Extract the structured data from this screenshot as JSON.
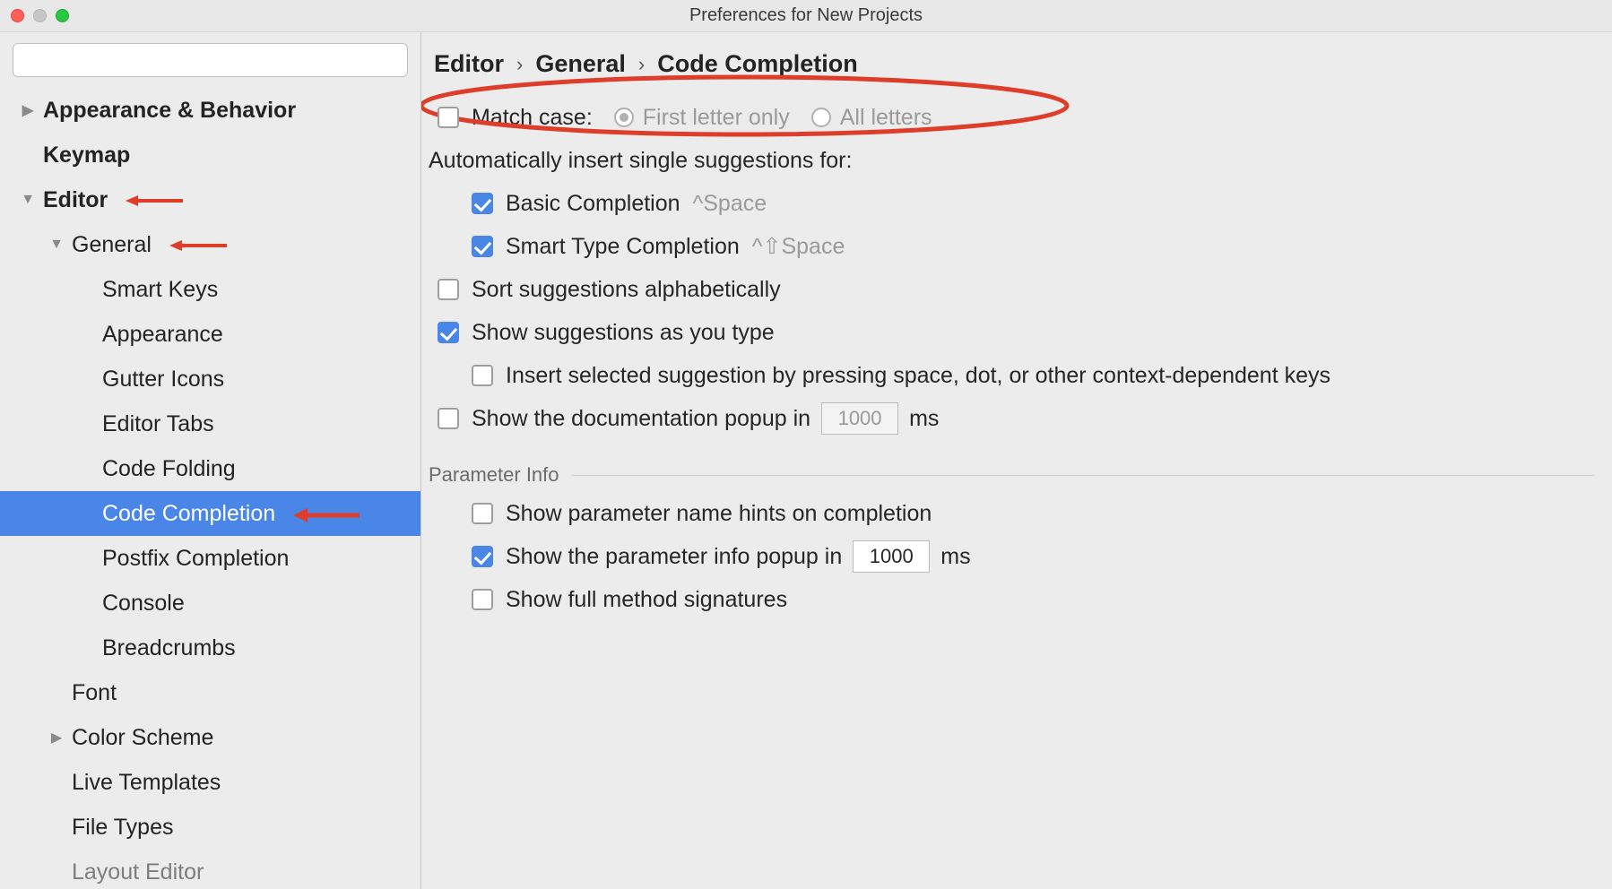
{
  "window": {
    "title": "Preferences for New Projects"
  },
  "search": {
    "value": ""
  },
  "sidebar": {
    "items": [
      {
        "label": "Appearance & Behavior"
      },
      {
        "label": "Keymap"
      },
      {
        "label": "Editor"
      },
      {
        "label": "General"
      },
      {
        "label": "Smart Keys"
      },
      {
        "label": "Appearance"
      },
      {
        "label": "Gutter Icons"
      },
      {
        "label": "Editor Tabs"
      },
      {
        "label": "Code Folding"
      },
      {
        "label": "Code Completion"
      },
      {
        "label": "Postfix Completion"
      },
      {
        "label": "Console"
      },
      {
        "label": "Breadcrumbs"
      },
      {
        "label": "Font"
      },
      {
        "label": "Color Scheme"
      },
      {
        "label": "Live Templates"
      },
      {
        "label": "File Types"
      },
      {
        "label": "Layout Editor"
      }
    ]
  },
  "breadcrumb": {
    "a": "Editor",
    "b": "General",
    "c": "Code Completion",
    "sep": "›"
  },
  "form": {
    "match_case_label": "Match case:",
    "match_case_checked": false,
    "first_letter_label": "First letter only",
    "all_letters_label": "All letters",
    "auto_insert_label": "Automatically insert single suggestions for:",
    "basic_label": "Basic Completion",
    "basic_shortcut": "^Space",
    "basic_checked": true,
    "smart_label": "Smart Type Completion",
    "smart_shortcut": "^⇧Space",
    "smart_checked": true,
    "sort_label": "Sort suggestions alphabetically",
    "sort_checked": false,
    "show_as_type_label": "Show suggestions as you type",
    "show_as_type_checked": true,
    "insert_selected_label": "Insert selected suggestion by pressing space, dot, or other context-dependent keys",
    "insert_selected_checked": false,
    "doc_popup_label_pre": "Show the documentation popup in",
    "doc_popup_value": "1000",
    "doc_popup_label_post": "ms",
    "doc_popup_checked": false,
    "parameter_info_section": "Parameter Info",
    "param_hints_label": "Show parameter name hints on completion",
    "param_hints_checked": false,
    "param_popup_label_pre": "Show the parameter info popup in",
    "param_popup_value": "1000",
    "param_popup_label_post": "ms",
    "param_popup_checked": true,
    "full_sig_label": "Show full method signatures",
    "full_sig_checked": false
  }
}
